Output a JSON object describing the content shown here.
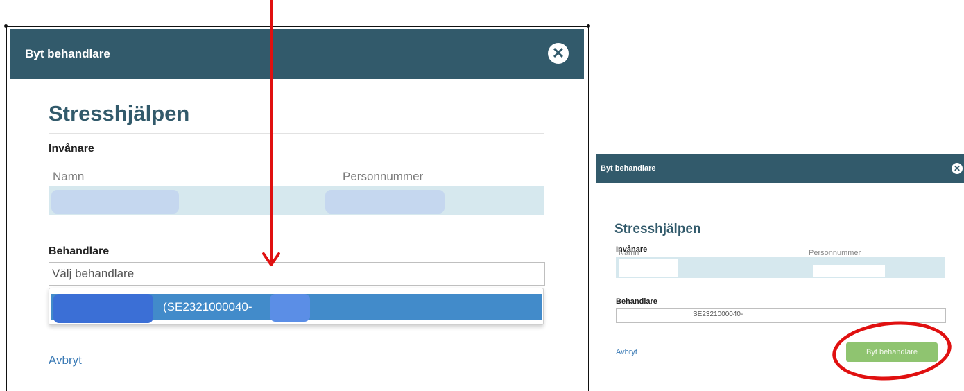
{
  "dialog_large": {
    "header_title": "Byt behandlare",
    "title": "Stresshjälpen",
    "section_invanare": "Invånare",
    "columns": {
      "namn": "Namn",
      "personnummer": "Personnummer"
    },
    "section_behandlare": "Behandlare",
    "input_placeholder": "Välj behandlare",
    "option_text": "(SE2321000040-",
    "cancel_label": "Avbryt",
    "close_glyph": "✕"
  },
  "dialog_small": {
    "header_title": "Byt behandlare",
    "title": "Stresshjälpen",
    "section_invanare": "Invånare",
    "columns": {
      "namn": "Namn",
      "personnummer": "Personnummer"
    },
    "section_behandlare": "Behandlare",
    "input_value": "SE2321000040-",
    "cancel_label": "Avbryt",
    "submit_label": "Byt behandlare",
    "close_glyph": "✕"
  },
  "colors": {
    "header_bg": "#325a6b",
    "accent_blue": "#428bca",
    "submit_green": "#8fc470",
    "annotation_red": "#e01010",
    "link_blue": "#3a7ab5"
  },
  "icons": {
    "close": "close-icon",
    "arrow": "red-arrow-annotation",
    "ring": "red-circle-annotation"
  }
}
